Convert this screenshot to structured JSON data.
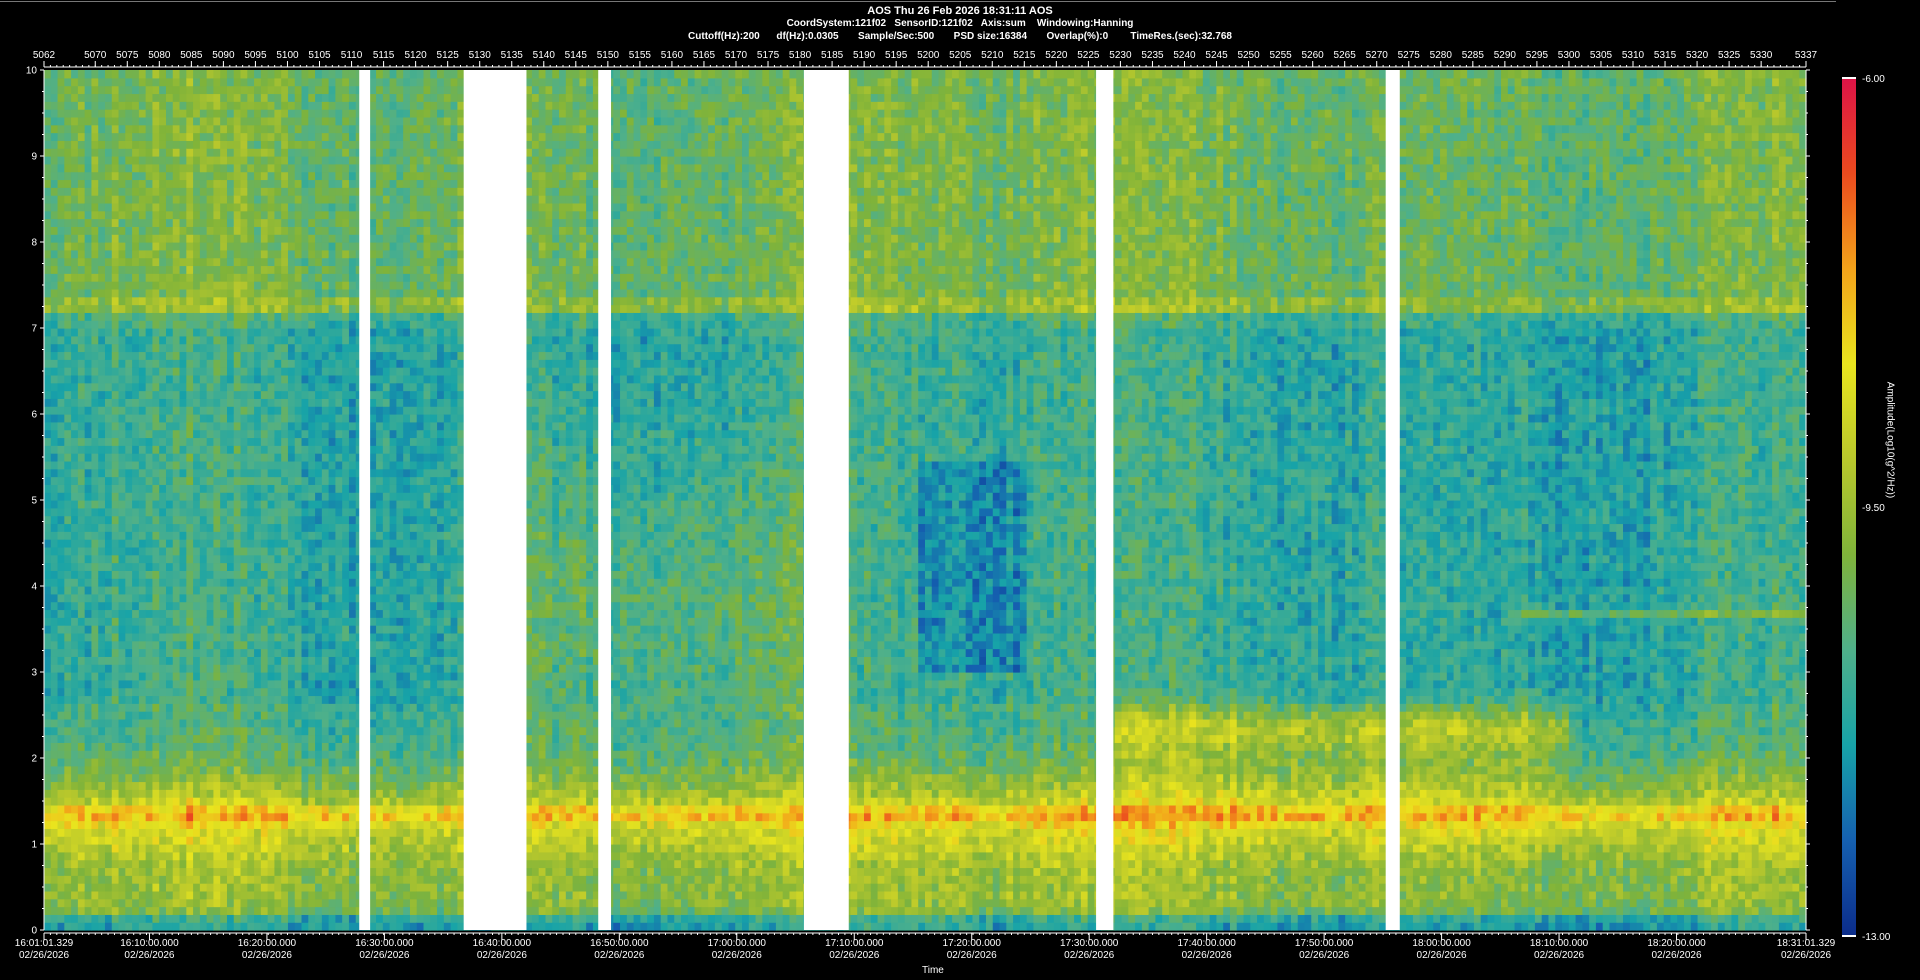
{
  "header": {
    "line1": "AOS  Thu 26 Feb 2026 18:31:11  AOS",
    "line2": "CoordSystem:121f02   SensorID:121f02   Axis:sum    Windowing:Hanning",
    "line3": "Cuttoff(Hz):200      df(Hz):0.0305       Sample/Sec:500       PSD size:16384       Overlap(%):0        TimeRes.(sec):32.768"
  },
  "chart_data": {
    "type": "heatmap",
    "title": "AOS  Thu 26 Feb 2026 18:31:11  AOS",
    "xlabel": "Time",
    "ylabel": "",
    "colorbar_label": "Amplitude(Log10(g^2/Hz))",
    "ylim": [
      0,
      10
    ],
    "y_ticks": [
      0,
      1,
      2,
      3,
      4,
      5,
      6,
      7,
      8,
      9,
      10
    ],
    "top_axis_ticks": [
      "5062",
      "5070",
      "5075",
      "5080",
      "5085",
      "5090",
      "5095",
      "5100",
      "5105",
      "5110",
      "5115",
      "5120",
      "5125",
      "5130",
      "5135",
      "5140",
      "5145",
      "5150",
      "5155",
      "5160",
      "5165",
      "5170",
      "5175",
      "5180",
      "5185",
      "5190",
      "5195",
      "5200",
      "5205",
      "5210",
      "5215",
      "5220",
      "5225",
      "5230",
      "5235",
      "5240",
      "5245",
      "5250",
      "5255",
      "5260",
      "5265",
      "5270",
      "5275",
      "5280",
      "5285",
      "5290",
      "5295",
      "5300",
      "5305",
      "5310",
      "5315",
      "5320",
      "5325",
      "5330",
      "5337"
    ],
    "top_axis_range": [
      5062,
      5337
    ],
    "time_ticks": [
      {
        "time": "16:01:01.329",
        "date": "02/26/2026"
      },
      {
        "time": "16:10:00.000",
        "date": "02/26/2026"
      },
      {
        "time": "16:20:00.000",
        "date": "02/26/2026"
      },
      {
        "time": "16:30:00.000",
        "date": "02/26/2026"
      },
      {
        "time": "16:40:00.000",
        "date": "02/26/2026"
      },
      {
        "time": "16:50:00.000",
        "date": "02/26/2026"
      },
      {
        "time": "17:00:00.000",
        "date": "02/26/2026"
      },
      {
        "time": "17:10:00.000",
        "date": "02/26/2026"
      },
      {
        "time": "17:20:00.000",
        "date": "02/26/2026"
      },
      {
        "time": "17:30:00.000",
        "date": "02/26/2026"
      },
      {
        "time": "17:40:00.000",
        "date": "02/26/2026"
      },
      {
        "time": "17:50:00.000",
        "date": "02/26/2026"
      },
      {
        "time": "18:00:00.000",
        "date": "02/26/2026"
      },
      {
        "time": "18:10:00.000",
        "date": "02/26/2026"
      },
      {
        "time": "18:20:00.000",
        "date": "02/26/2026"
      },
      {
        "time": "18:31:01.329",
        "date": "02/26/2026"
      }
    ],
    "colorbar": {
      "min": -13.0,
      "max": -6.0,
      "labels": [
        "-6.00",
        "-9.50",
        "-13.00"
      ]
    },
    "colorscale": [
      "#0b2c8a",
      "#1560b0",
      "#17a3a8",
      "#4fb08a",
      "#7fb33a",
      "#b9c82c",
      "#e9e51e",
      "#f3a21a",
      "#eb4a1e",
      "#dd1347"
    ],
    "data_gaps_top_axis": [
      [
        5111.2,
        5112.9
      ],
      [
        5127.5,
        5137.3
      ],
      [
        5148.5,
        5150.5
      ],
      [
        5180.6,
        5187.6
      ],
      [
        5226.2,
        5228.9
      ],
      [
        5271.4,
        5273.6
      ]
    ],
    "features": [
      {
        "y_range": [
          0.8,
          1.7
        ],
        "level": -9.0
      },
      {
        "y": 1.35,
        "level": -7.8
      },
      {
        "y": 7.25,
        "level": -9.6
      },
      {
        "y_range": [
          2.1,
          2.6
        ],
        "x_range": [
          5229,
          5300
        ],
        "level": -7.5
      },
      {
        "y": 3.7,
        "x_range": [
          5290,
          5337
        ],
        "level": -9.6
      }
    ]
  }
}
